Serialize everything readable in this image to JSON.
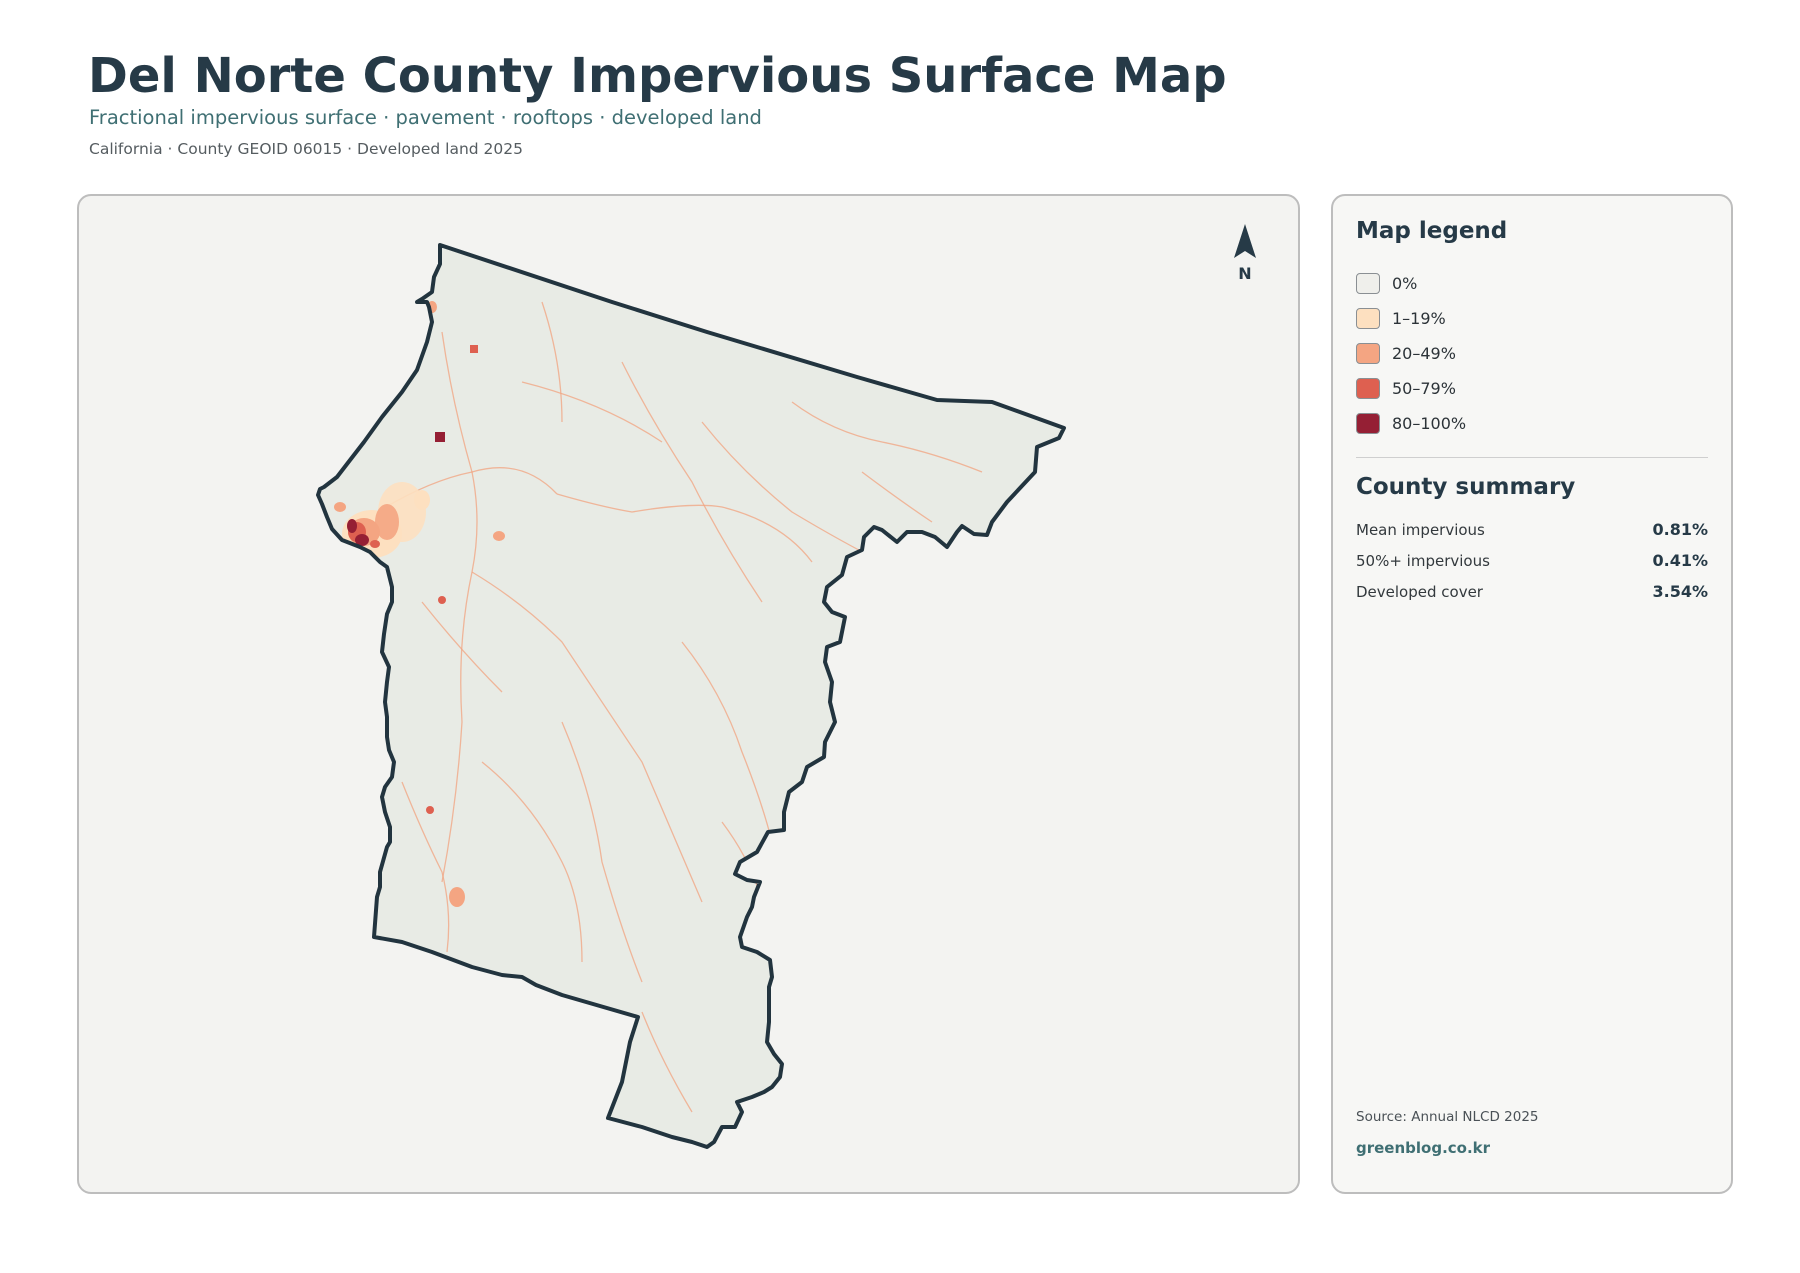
{
  "header": {
    "title": "Del Norte County Impervious Surface Map",
    "subtitle": "Fractional impervious surface · pavement · rooftops · developed land",
    "meta": "California · County GEOID 06015 · Developed land 2025"
  },
  "map": {
    "north_arrow_label": "N",
    "county_fill": "#e8ebe5",
    "boundary_color": "#22343f",
    "icon": "north-arrow-icon"
  },
  "legend": {
    "title": "Map legend",
    "items": [
      {
        "label": "0%",
        "color": "#efefeb"
      },
      {
        "label": "1–19%",
        "color": "#fde0c0"
      },
      {
        "label": "20–49%",
        "color": "#f4a582"
      },
      {
        "label": "50–79%",
        "color": "#de6050"
      },
      {
        "label": "80–100%",
        "color": "#951f34"
      }
    ]
  },
  "summary": {
    "title": "County summary",
    "rows": [
      {
        "label": "Mean impervious",
        "value": "0.81%"
      },
      {
        "label": "50%+ impervious",
        "value": "0.41%"
      },
      {
        "label": "Developed cover",
        "value": "3.54%"
      }
    ]
  },
  "footer": {
    "source": "Source: Annual NLCD 2025",
    "site": "greenblog.co.kr"
  }
}
